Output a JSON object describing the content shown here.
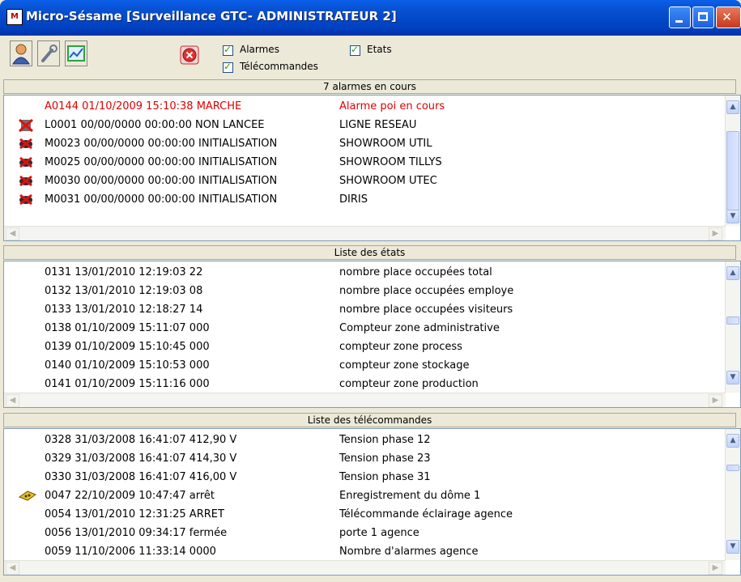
{
  "window": {
    "title": "Micro-Sésame [Surveillance GTC- ADMINISTRATEUR 2]",
    "app_icon": "app-logo-icon",
    "buttons": [
      "minimize-icon",
      "maximize-icon",
      "close-icon"
    ]
  },
  "toolbar": {
    "tools": [
      "user-icon",
      "wrench-icon",
      "chart-icon"
    ],
    "stop_icon": "stop-icon",
    "checkboxes": {
      "alarmes": {
        "label": "Alarmes",
        "checked": true
      },
      "etats": {
        "label": "Etats",
        "checked": true
      },
      "telecommandes": {
        "label": "Télécommandes",
        "checked": true
      }
    }
  },
  "alarms": {
    "header": "7 alarmes en cours",
    "rows": [
      {
        "c1": "A0144 01/10/2009 15:10:38 MARCHE",
        "c2": "Alarme poi en cours",
        "red": true,
        "icon": ""
      },
      {
        "c1": "L0001 00/00/0000 00:00:00 NON LANCEE",
        "c2": "LIGNE RESEAU",
        "red": false,
        "icon": "network-error-icon"
      },
      {
        "c1": "M0023 00/00/0000 00:00:00 INITIALISATION",
        "c2": "SHOWROOM UTIL",
        "red": false,
        "icon": "module-error-icon"
      },
      {
        "c1": "M0025 00/00/0000 00:00:00 INITIALISATION",
        "c2": "SHOWROOM TILLYS",
        "red": false,
        "icon": "module-error-icon"
      },
      {
        "c1": "M0030 00/00/0000 00:00:00 INITIALISATION",
        "c2": "SHOWROOM UTEC",
        "red": false,
        "icon": "module-error-icon"
      },
      {
        "c1": "M0031 00/00/0000 00:00:00 INITIALISATION",
        "c2": "DIRIS",
        "red": false,
        "icon": "module-error-icon"
      }
    ]
  },
  "etats": {
    "header": "Liste des états",
    "rows": [
      {
        "c1": "0131 13/01/2010 12:19:03 22",
        "c2": "nombre place occupées total"
      },
      {
        "c1": "0132 13/01/2010 12:19:03 08",
        "c2": "nombre place occupées employe"
      },
      {
        "c1": "0133 13/01/2010 12:18:27 14",
        "c2": "nombre place occupées visiteurs"
      },
      {
        "c1": "0138 01/10/2009 15:11:07 000",
        "c2": "Compteur zone administrative"
      },
      {
        "c1": "0139 01/10/2009 15:10:45 000",
        "c2": "compteur zone process"
      },
      {
        "c1": "0140 01/10/2009 15:10:53 000",
        "c2": "compteur  zone stockage"
      },
      {
        "c1": "0141 01/10/2009 15:11:16 000",
        "c2": "compteur zone production"
      }
    ]
  },
  "telecommandes": {
    "header": "Liste des télécommandes",
    "rows": [
      {
        "c1": "0328 31/03/2008 16:41:07 412,90 V",
        "c2": "Tension phase 12",
        "icon": ""
      },
      {
        "c1": "0329 31/03/2008 16:41:07 414,30 V",
        "c2": "Tension phase 23",
        "icon": ""
      },
      {
        "c1": "0330 31/03/2008 16:41:07 416,00 V",
        "c2": "Tension phase 31",
        "icon": ""
      },
      {
        "c1": "0047 22/10/2009 10:47:47 arrêt",
        "c2": "Enregistrement du dôme 1",
        "icon": "camera-icon"
      },
      {
        "c1": "0054 13/01/2010 12:31:25 ARRET",
        "c2": "Télécommande éclairage agence",
        "icon": ""
      },
      {
        "c1": "0056 13/01/2010 09:34:17 fermée",
        "c2": "porte 1 agence",
        "icon": ""
      },
      {
        "c1": "0059 11/10/2006 11:33:14 0000",
        "c2": "Nombre d'alarmes agence",
        "icon": ""
      }
    ]
  }
}
